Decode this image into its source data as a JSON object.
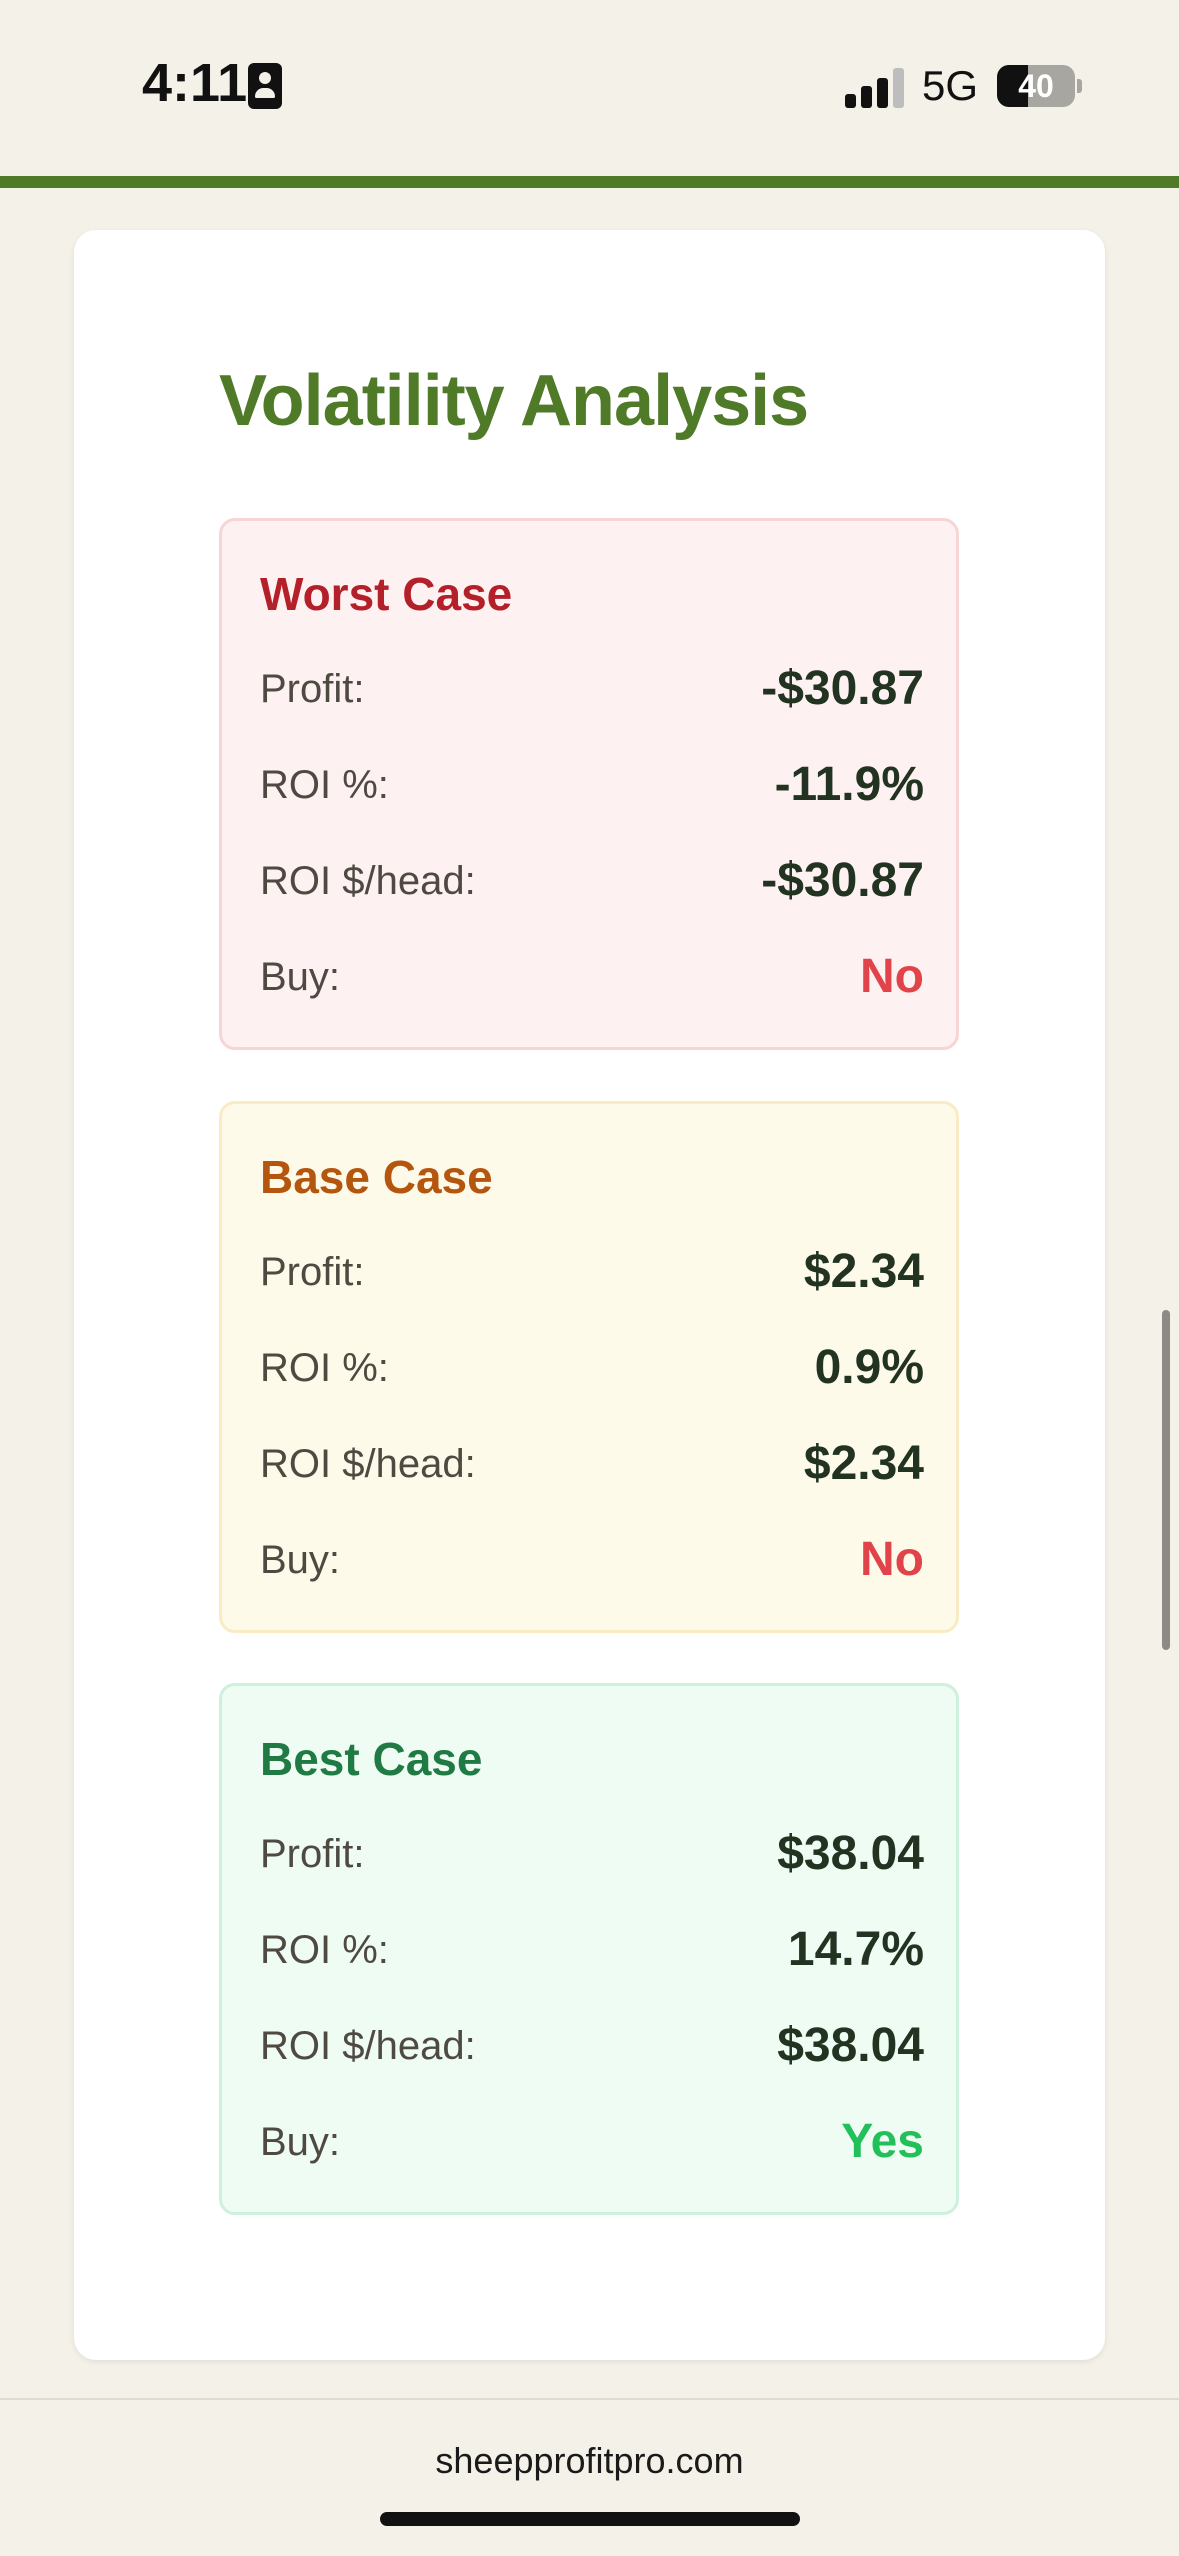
{
  "status_bar": {
    "time": "4:11",
    "network": "5G",
    "battery_level": "40"
  },
  "site": {
    "url": "sheepprofitpro.com",
    "accent_color": "#4f7a28"
  },
  "volatility": {
    "title": "Volatility Analysis",
    "cases": [
      {
        "title": "Worst Case",
        "profit_label": "Profit:",
        "profit": "-$30.87",
        "roi_pct_label": "ROI %:",
        "roi_pct": "-11.9%",
        "roi_head_label": "ROI $/head:",
        "roi_head": "-$30.87",
        "buy_label": "Buy:",
        "buy": "No"
      },
      {
        "title": "Base Case",
        "profit_label": "Profit:",
        "profit": "$2.34",
        "roi_pct_label": "ROI %:",
        "roi_pct": "0.9%",
        "roi_head_label": "ROI $/head:",
        "roi_head": "$2.34",
        "buy_label": "Buy:",
        "buy": "No"
      },
      {
        "title": "Best Case",
        "profit_label": "Profit:",
        "profit": "$38.04",
        "roi_pct_label": "ROI %:",
        "roi_pct": "14.7%",
        "roi_head_label": "ROI $/head:",
        "roi_head": "$38.04",
        "buy_label": "Buy:",
        "buy": "Yes"
      }
    ]
  },
  "icons": {
    "contact": "contact-card-icon",
    "signal": "cellular-signal-icon",
    "battery": "battery-icon"
  }
}
